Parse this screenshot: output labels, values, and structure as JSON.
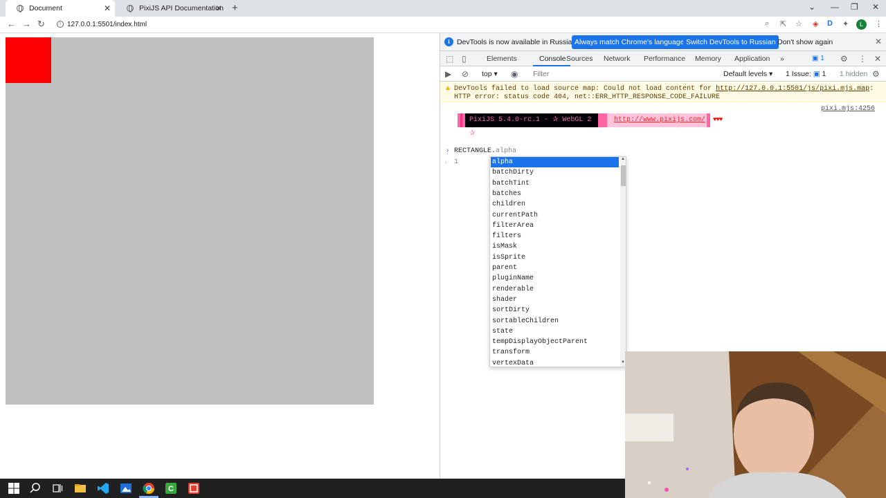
{
  "browser": {
    "tabs": [
      {
        "title": "Document",
        "active": true
      },
      {
        "title": "PixiJS API Documentation",
        "active": false
      }
    ],
    "new_tab": "+",
    "url": "127.0.0.1:5501/index.html",
    "avatar_letter": "L"
  },
  "page": {
    "canvas_color": "#c0c0c0",
    "rect_color": "#ff0000"
  },
  "devtools": {
    "infobar": {
      "message": "DevTools is now available in Russian!",
      "btn_match": "Always match Chrome's language",
      "btn_switch": "Switch DevTools to Russian",
      "dont_show": "Don't show again"
    },
    "tabs": [
      "Elements",
      "Console",
      "Sources",
      "Network",
      "Performance",
      "Memory",
      "Application"
    ],
    "active_tab": "Console",
    "more_tabs": "»",
    "issues_badge": "1",
    "console_toolbar": {
      "context": "top",
      "filter_placeholder": "Filter",
      "levels": "Default levels",
      "issues": "1 Issue:",
      "issues_num": "1",
      "hidden": "1 hidden"
    },
    "warning": {
      "prefix": "DevTools failed to load source map: Could not load content for ",
      "link": "http://127.0.0.1:5501/js/pixi.mjs.map",
      "suffix": ": HTTP error: status code 404, net::ERR_HTTP_RESPONSE_CODE_FAILURE"
    },
    "pixi_log": {
      "source": "pixi.mjs:4256",
      "title": "PixiJS 5.4.0-rc.1 - ✰ WebGL 2 ✰",
      "link": "http://www.pixijs.com/",
      "hearts": "♥♥♥"
    },
    "input": {
      "typed": "RECTANGLE.",
      "ghost": "alpha"
    },
    "result": "1",
    "autocomplete": [
      "alpha",
      "batchDirty",
      "batchTint",
      "batches",
      "children",
      "currentPath",
      "filterArea",
      "filters",
      "isMask",
      "isSprite",
      "parent",
      "pluginName",
      "renderable",
      "shader",
      "sortDirty",
      "sortableChildren",
      "state",
      "tempDisplayObjectParent",
      "transform",
      "vertexData"
    ]
  }
}
